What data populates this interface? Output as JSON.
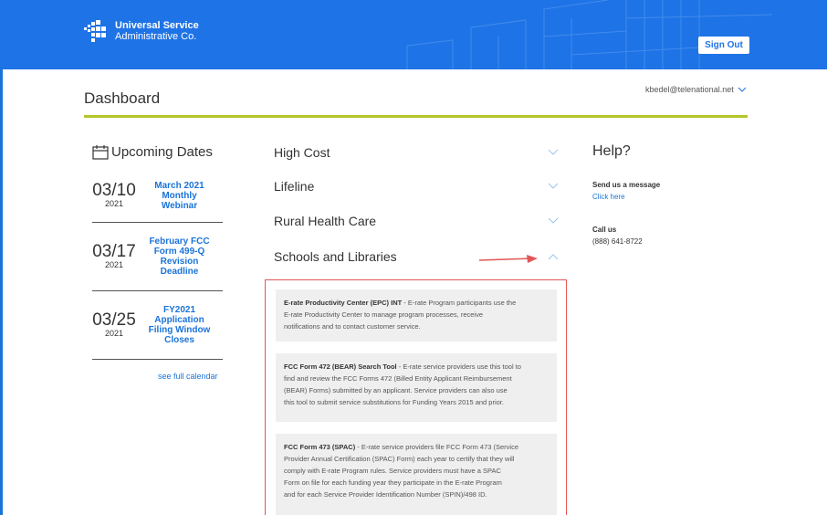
{
  "header": {
    "org_line1": "Universal Service",
    "org_line2": "Administrative Co.",
    "sign_out_label": "Sign Out"
  },
  "page": {
    "title": "Dashboard",
    "user_email": "kbedel@telenational.net"
  },
  "upcoming": {
    "title": "Upcoming Dates",
    "items": [
      {
        "date": "03/10",
        "year": "2021",
        "event_lines": [
          "March 2021",
          "Monthly",
          "Webinar"
        ]
      },
      {
        "date": "03/17",
        "year": "2021",
        "event_lines": [
          "February FCC",
          "Form 499-Q",
          "Revision",
          "Deadline"
        ]
      },
      {
        "date": "03/25",
        "year": "2021",
        "event_lines": [
          "FY2021",
          "Application",
          "Filing Window",
          "Closes"
        ]
      }
    ],
    "full_calendar_label": "see full calendar"
  },
  "programs": {
    "items": [
      {
        "label": "High Cost",
        "expanded": false
      },
      {
        "label": "Lifeline",
        "expanded": false
      },
      {
        "label": "Rural Health Care",
        "expanded": false
      },
      {
        "label": "Schools and Libraries",
        "expanded": true
      }
    ],
    "cards": [
      {
        "title": "E-rate Productivity Center (EPC) INT",
        "lines": [
          "E-rate Program participants use the",
          "E-rate Productivity Center to manage program processes, receive",
          "notifications and to contact customer service."
        ]
      },
      {
        "title": "FCC Form 472 (BEAR) Search Tool",
        "lines": [
          "E-rate service providers use this tool to",
          "find and review the FCC Forms 472 (Billed Entity Applicant Reimbursement",
          "(BEAR) Forms) submitted by an applicant. Service providers can also use",
          "this tool to submit service substitutions for Funding Years 2015 and prior."
        ]
      },
      {
        "title": "FCC Form 473 (SPAC)",
        "lines": [
          "E-rate service providers file FCC Form 473 (Service",
          "Provider Annual Certification (SPAC) Form) each year to certify that they will",
          "comply with E-rate Program rules. Service providers must have a SPAC",
          "Form on file for each funding year they participate in the E-rate Program",
          "and for each Service Provider Identification Number (SPIN)/498 ID."
        ]
      }
    ]
  },
  "help": {
    "title": "Help?",
    "message_label": "Send us a message",
    "message_link": "Click here",
    "call_label": "Call us",
    "phone": "(888) 641-8722"
  },
  "colors": {
    "header_blue": "#1e73e6",
    "link_blue": "#1a73d9",
    "accent_rule": "#b5c62a",
    "annotation_red": "#e25656"
  }
}
